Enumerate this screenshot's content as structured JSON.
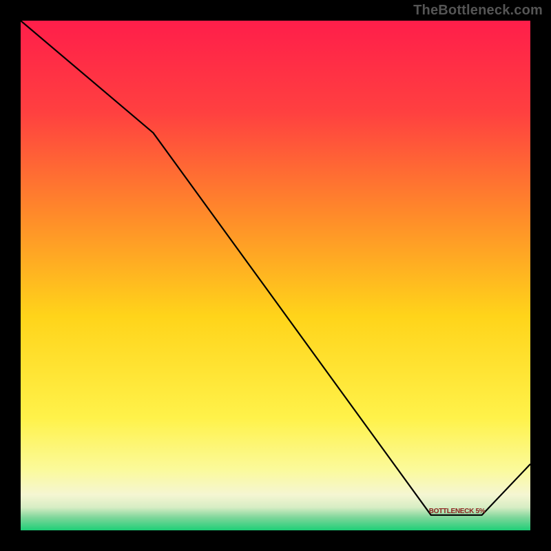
{
  "watermark": "TheBottleneck.com",
  "annotation": {
    "label": "BOTTLENECK 5%",
    "x_center_frac": 0.855,
    "y_frac": 0.963
  },
  "chart_data": {
    "type": "line",
    "title": "",
    "xlabel": "",
    "ylabel": "",
    "xlim": [
      0,
      100
    ],
    "ylim": [
      0,
      100
    ],
    "grid": false,
    "background_gradient": {
      "type": "vertical-linear",
      "stops": [
        {
          "t": 0.0,
          "color": "#ff1e4a"
        },
        {
          "t": 0.18,
          "color": "#ff4040"
        },
        {
          "t": 0.38,
          "color": "#ff8a2a"
        },
        {
          "t": 0.58,
          "color": "#ffd41a"
        },
        {
          "t": 0.78,
          "color": "#fff24a"
        },
        {
          "t": 0.88,
          "color": "#fbfa9a"
        },
        {
          "t": 0.93,
          "color": "#f5f6d2"
        },
        {
          "t": 0.955,
          "color": "#d7edc4"
        },
        {
          "t": 0.975,
          "color": "#7ed69a"
        },
        {
          "t": 1.0,
          "color": "#1ecf77"
        }
      ]
    },
    "series": [
      {
        "name": "bottleneck-curve",
        "stroke": "#000000",
        "stroke_width": 2.2,
        "x": [
          0,
          26,
          80.5,
          90.5,
          100
        ],
        "values": [
          100,
          78,
          3,
          3,
          13
        ]
      }
    ]
  }
}
